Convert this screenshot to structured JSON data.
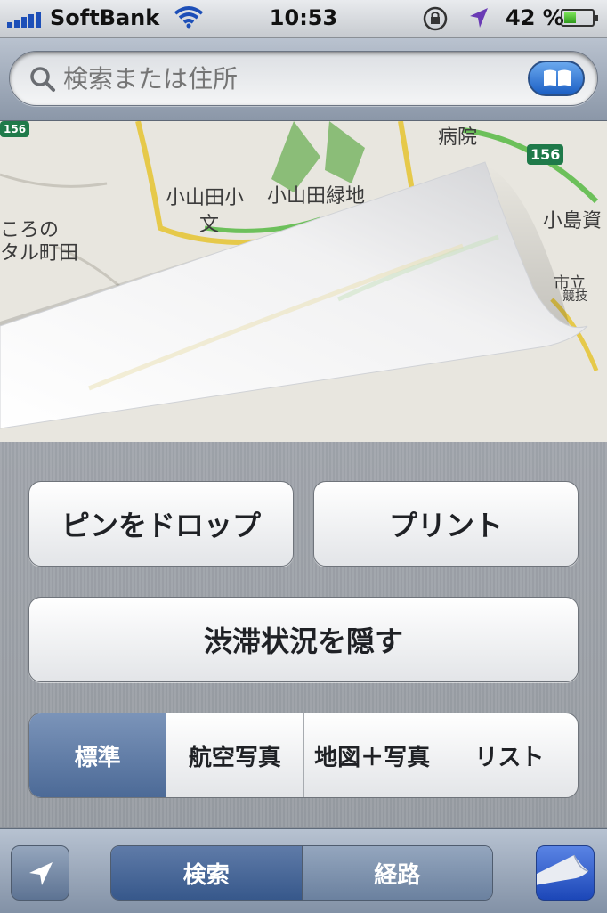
{
  "status_bar": {
    "carrier": "SoftBank",
    "time": "10:53",
    "battery_pct": "42 %",
    "battery_level": 0.42
  },
  "search": {
    "placeholder": "検索または住所"
  },
  "map_labels": [
    "病院",
    "156",
    "小山田小",
    "文",
    "小山田緑地",
    "ころの",
    "タル町田",
    "小島資",
    "市立",
    "競技",
    "156"
  ],
  "options": {
    "drop_pin": "ピンをドロップ",
    "print": "プリント",
    "hide_traffic": "渋滞状況を隠す",
    "map_types": [
      "標準",
      "航空写真",
      "地図＋写真",
      "リスト"
    ],
    "selected_map_type": "標準"
  },
  "toolbar": {
    "search_tab": "検索",
    "directions_tab": "経路",
    "selected_tab": "検索"
  },
  "icons": {
    "search": "search-icon",
    "bookmarks": "bookmarks-icon",
    "location": "location-arrow-icon",
    "page_curl": "page-curl-icon",
    "wifi": "wifi-icon",
    "rotation_lock": "rotation-lock-icon"
  },
  "colors": {
    "selected_segment": "#4c6a97",
    "toolbar": "#8291a6",
    "battery": "#2e9a1c"
  }
}
